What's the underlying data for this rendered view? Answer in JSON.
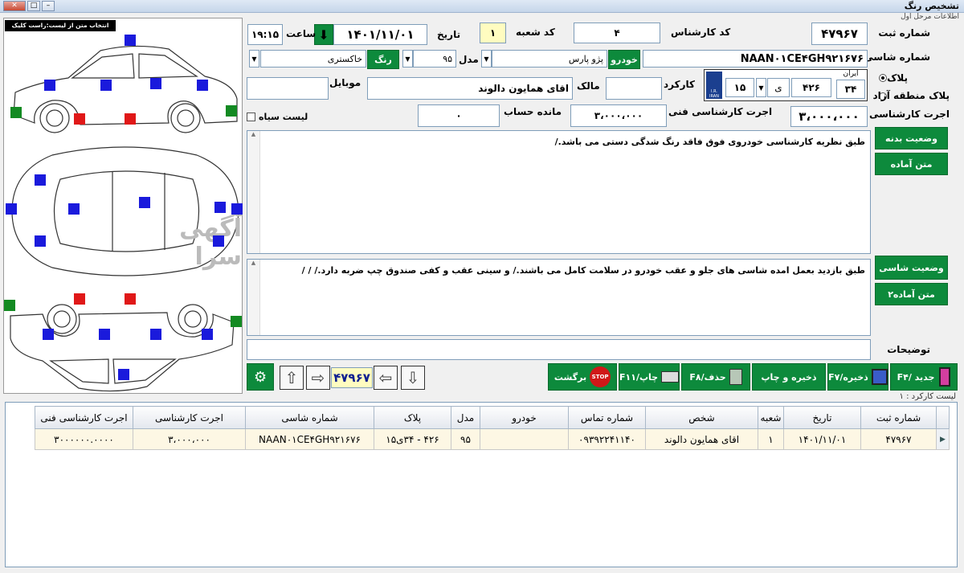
{
  "window": {
    "title": "تشخیص رنگ",
    "section_caption": "اطلاعات مرحل اول"
  },
  "left_panel": {
    "hint": "انتخاب متن از لیست:راست کلیک روی دکمه",
    "watermark": "آگهی سرا"
  },
  "form": {
    "reg_no_label": "شماره ثبت",
    "reg_no": "۴۷۹۶۷",
    "expert_code_label": "کد کارشناس",
    "expert_code": "۴",
    "branch_code_label": "کد شعبه",
    "branch_code": "۱",
    "date_label": "تاریخ",
    "date": "۱۴۰۱/۱۱/۰۱",
    "time_label": "ساعت",
    "time": "۱۹:۱۵",
    "chassis_label": "شماره شاسی",
    "chassis": "NAAN۰۱CE۴GH۹۲۱۶۷۶",
    "vehicle_btn": "خودرو",
    "vehicle": "پژو پارس",
    "model_label": "مدل",
    "model": "۹۵",
    "color_btn": "رنگ",
    "color": "خاکستری",
    "plate_radio": "پلاک",
    "free_zone_radio": "پلاک منطقه آزاد",
    "plate": {
      "iran_label": "ایران",
      "ir_label": "I.R. IRAN",
      "region": "۳۴",
      "number": "۴۲۶",
      "letter": "ی",
      "series": "۱۵"
    },
    "mileage_label": "کارکرد",
    "mileage": "",
    "owner_label": "مالک",
    "owner": "اقای همایون دالوند",
    "mobile_label": "موبایل",
    "mobile": "",
    "fee_label": "اجرت کارشناسی",
    "fee": "۳،۰۰۰،۰۰۰",
    "tech_fee_label": "اجرت کارشناسی فنی",
    "tech_fee": "۳،۰۰۰،۰۰۰",
    "balance_label": "مانده حساب",
    "balance": "۰",
    "blacklist_label": "لیست سیاه",
    "body_status_btn": "وضعیت بدنه",
    "ready_text_btn": "متن آماده",
    "body_text": "طبق نظریه کارشناسی خودروی فوق فاقد رنگ شدگی دستی می باشد./",
    "chassis_status_btn": "وضعیت شاسی",
    "ready_text2_btn": "متن آماده۲",
    "chassis_text": "طبق بازدید بعمل امده  شاسی های جلو و عقب خودرو در سلامت کامل می باشند./ و سینی عقب و کفی صندوق چپ ضربه دارد./ / /",
    "desc_label": "توضیحات",
    "desc": ""
  },
  "toolbar": {
    "record_no": "۴۷۹۶۷",
    "new_btn": "جدید /F۴",
    "save_btn": "ذخیره/F۷",
    "save_print_btn": "ذخیره و چاپ",
    "delete_btn": "حذف/F۸",
    "print_btn": "چاپ/F۱۱",
    "return_btn": "برگشت",
    "stop_icon_text": "STOP"
  },
  "list_caption": "لیست کارکرد : ۱",
  "table": {
    "headers": [
      "شماره ثبت",
      "تاریخ",
      "شعبه",
      "شخص",
      "شماره تماس",
      "خودرو",
      "مدل",
      "پلاک",
      "شماره شاسی",
      "اجرت کارشناسی",
      "اجرت کارشناسی فنی"
    ],
    "rows": [
      [
        "۴۷۹۶۷",
        "۱۴۰۱/۱۱/۰۱",
        "۱",
        "اقای همایون دالوند",
        "۰۹۳۹۲۲۴۱۱۴۰",
        "",
        "۹۵",
        "۴۲۶ - ۳۴ی۱۵",
        "NAAN۰۱CE۴GH۹۲۱۶۷۶",
        "۳،۰۰۰،۰۰۰",
        "۳۰۰۰۰۰۰.۰۰۰۰"
      ]
    ]
  },
  "colors": {
    "green": "#0d8a3c",
    "blue_marker": "#1a1adc",
    "red_marker": "#e01818",
    "green_marker": "#138a22"
  }
}
